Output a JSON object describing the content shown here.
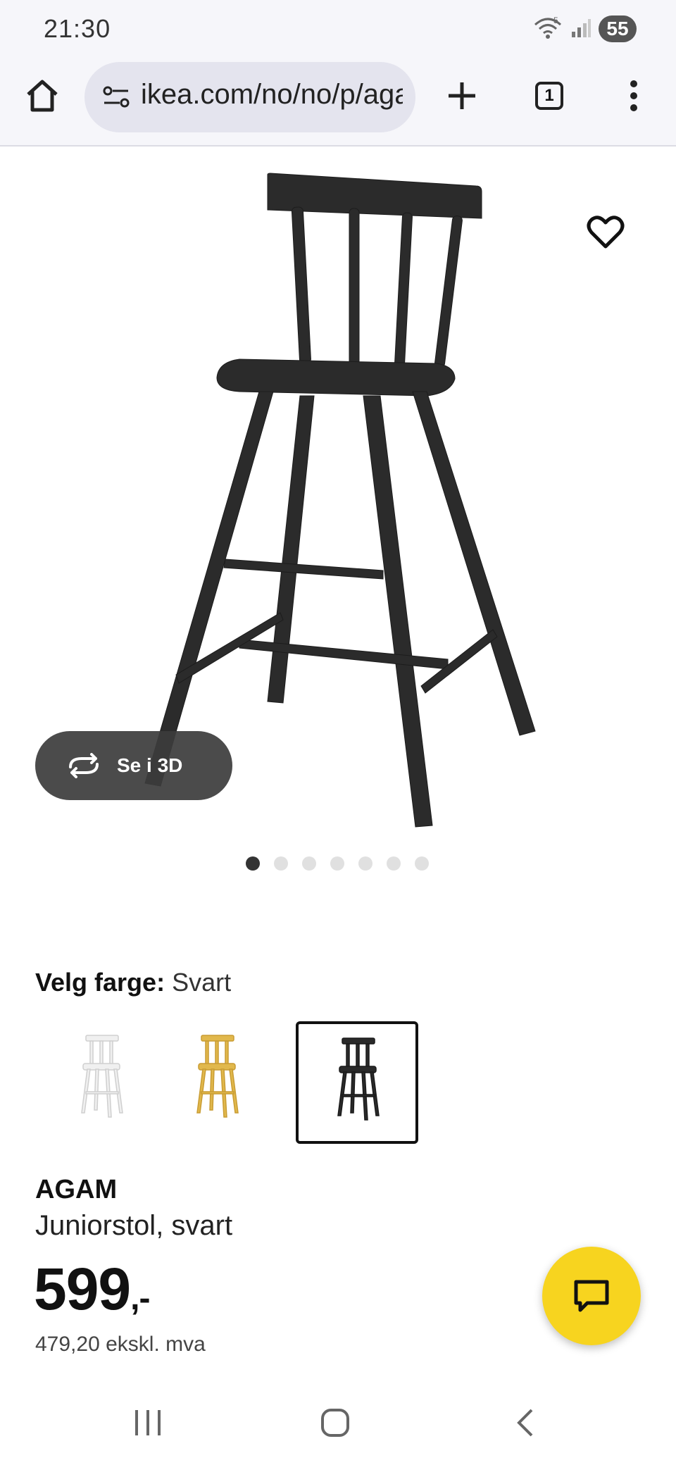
{
  "status": {
    "time": "21:30",
    "wifi_label": "5",
    "battery": "55"
  },
  "browser": {
    "url": "ikea.com/no/no/p/agam-juniorstol",
    "tab_count": "1"
  },
  "product": {
    "see_3d_label": "Se i 3D",
    "image_dots_count": 7,
    "active_dot": 1,
    "color_key": "Velg farge:",
    "color_value": "Svart",
    "swatches": [
      {
        "color": "white",
        "hex": "#f2f2f2"
      },
      {
        "color": "yellow",
        "hex": "#e1b84c"
      },
      {
        "color": "black",
        "hex": "#2a2a2a"
      }
    ],
    "selected_swatch": 2,
    "name": "AGAM",
    "description": "Juniorstol, svart",
    "price": "599",
    "price_suffix": ",-",
    "price_ex_vat": "479,20 ekskl. mva"
  },
  "colors": {
    "chat_fab": "#f7d41f",
    "chair": "#2b2b2b"
  }
}
